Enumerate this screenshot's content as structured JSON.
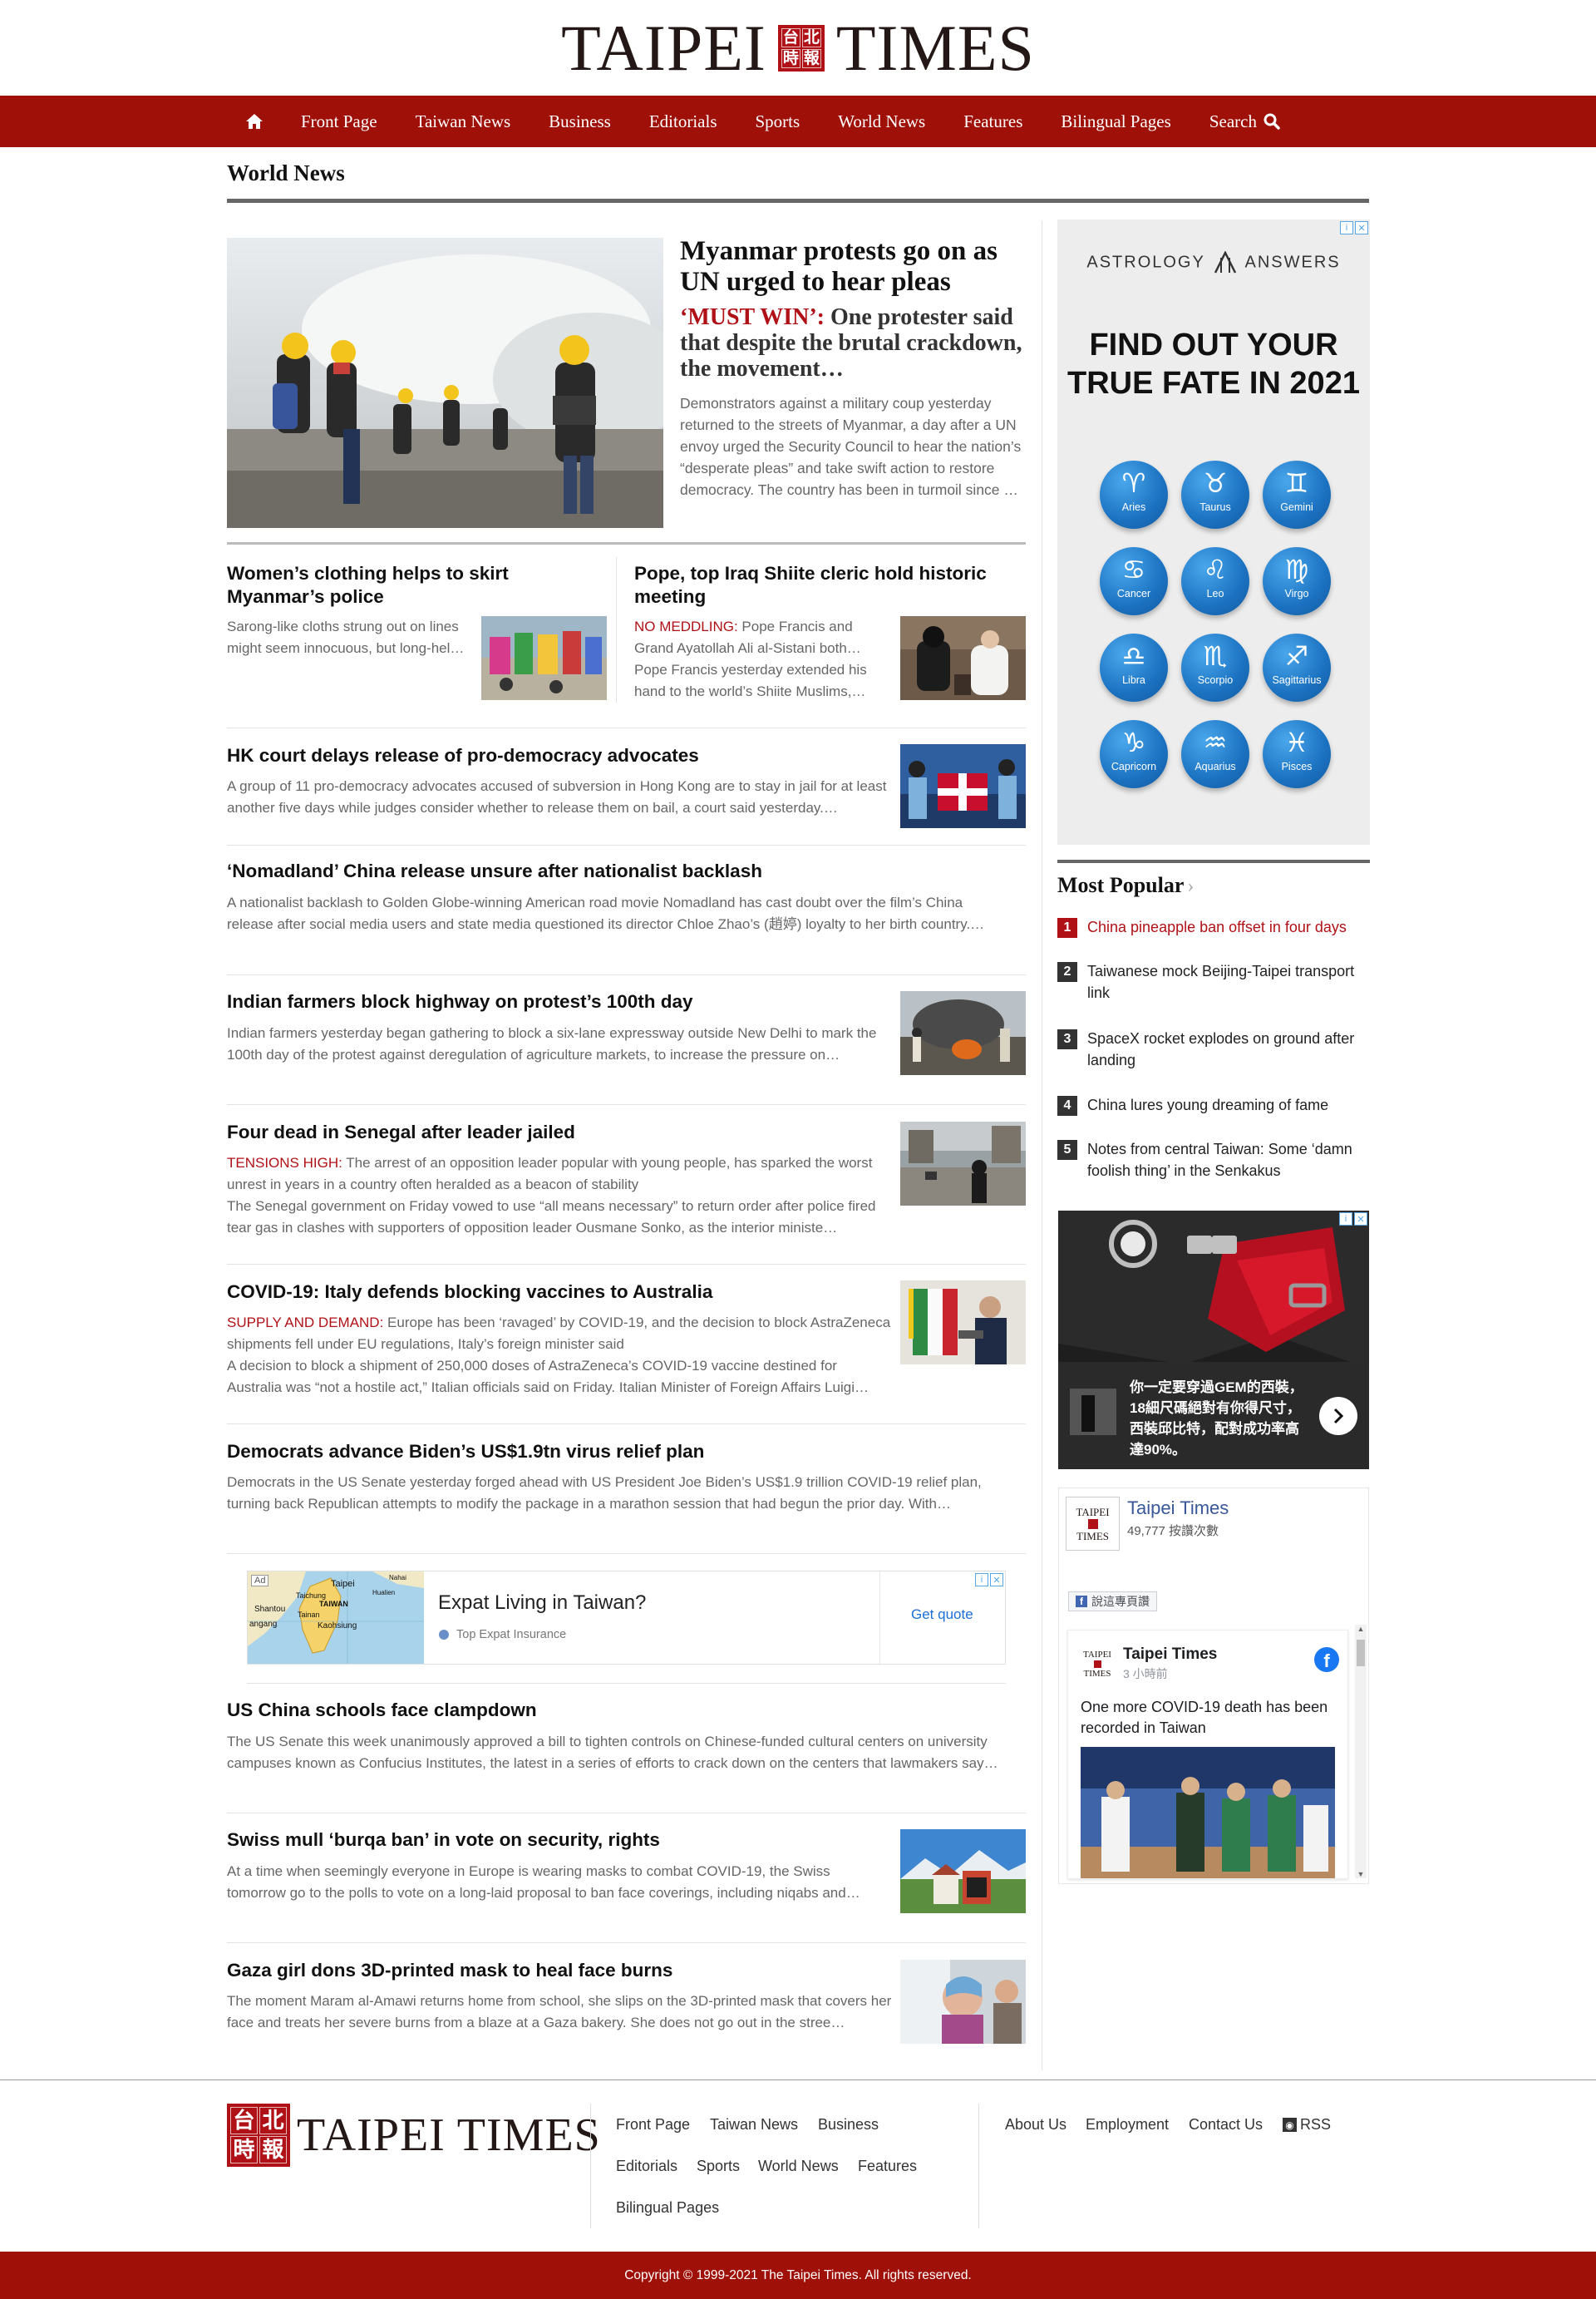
{
  "header": {
    "logo_left": "TAIPEI",
    "logo_right": "TIMES",
    "seal_chars": [
      "台",
      "北",
      "時",
      "報"
    ]
  },
  "nav": {
    "items": [
      "Front Page",
      "Taiwan News",
      "Business",
      "Editorials",
      "Sports",
      "World News",
      "Features",
      "Bilingual Pages"
    ],
    "search_label": "Search",
    "home_icon": "home-icon",
    "search_icon": "search-icon"
  },
  "section": {
    "title": "World News"
  },
  "lead": {
    "title": "Myanmar protests go on as UN urged to hear pleas",
    "kicker": "‘MUST WIN’:",
    "subtitle": " One protester said that despite the brutal crackdown, the movement…",
    "body": "Demonstrators against a military coup yesterday returned to the streets of Myanmar, a day after a UN envoy urged the Security Council to hear the nation’s “desperate pleas” and take swift action to restore democracy. The country has been in turmoil since …"
  },
  "pair": [
    {
      "title": "Women’s clothing helps to skirt Myanmar’s police",
      "body": "Sarong-like cloths strung out on lines might seem innocuous, but long-hel…"
    },
    {
      "title": "Pope, top Iraq Shiite cleric hold historic meeting",
      "kicker": "NO MEDDLING:",
      "body1": " Pope Francis and Grand Ayatollah Ali al-Sistani both…",
      "body2": "Pope Francis yesterday extended his hand to the world’s Shiite Muslims,…"
    }
  ],
  "stories": [
    {
      "title": "HK court delays release of pro-democracy advocates",
      "body": "A group of 11 pro-democracy advocates accused of subversion in Hong Kong are to stay in jail for at least another five days while judges consider whether to release them on bail, a court said yesterday.…"
    },
    {
      "title": "‘Nomadland’ China release unsure after nationalist backlash",
      "body": "A nationalist backlash to Golden Globe-winning American road movie Nomadland has cast doubt over the film’s China release after social media users and state media questioned its director Chloe Zhao’s (趙婷) loyalty to her birth country.…"
    },
    {
      "title": "Indian farmers block highway on protest’s 100th day",
      "body": "Indian farmers yesterday began gathering to block a six-lane expressway outside New Delhi to mark the 100th day of the protest against deregulation of agriculture markets, to increase the pressure on…"
    },
    {
      "title": "Four dead in Senegal after leader jailed",
      "kicker": "TENSIONS HIGH:",
      "body1": " The arrest of an opposition leader popular with young people, has sparked the worst unrest in years in a country often heralded as a beacon of stability",
      "body2": "The Senegal government on Friday vowed to use “all means necessary” to return order after police fired tear gas in clashes with supporters of opposition leader Ousmane Sonko, as the interior ministe…"
    },
    {
      "title": "COVID-19: Italy defends blocking vaccines to Australia",
      "kicker": "SUPPLY AND DEMAND:",
      "body1": " Europe has been ‘ravaged’ by COVID-19, and the decision to block AstraZeneca shipments fell under EU regulations, Italy’s foreign minister said",
      "body2": "A decision to block a shipment of 250,000 doses of AstraZeneca’s COVID-19 vaccine destined for Australia was “not a hostile act,” Italian officials said on Friday. Italian Minister of Foreign Affairs Luigi…"
    },
    {
      "title": "Democrats advance Biden’s US$1.9tn virus relief plan",
      "body": "Democrats in the US Senate yesterday forged ahead with US President Joe Biden’s US$1.9 trillion COVID-19 relief plan, turning back Republican attempts to modify the package in a marathon session that had begun the prior day. With…"
    },
    {
      "title": "US China schools face clampdown",
      "body": "The US Senate this week unanimously approved a bill to tighten controls on Chinese-funded cultural centers on university campuses known as Confucius Institutes, the latest in a series of efforts to crack down on the centers that lawmakers say…"
    },
    {
      "title": "Swiss mull ‘burqa ban’ in vote on security, rights",
      "body": "At a time when seemingly everyone in Europe is wearing masks to combat COVID-19, the Swiss tomorrow go to the polls to vote on a long-laid proposal to ban face coverings, including niqabs and…"
    },
    {
      "title": "Gaza girl dons 3D-printed mask to heal face burns",
      "body": "The moment Maram al-Amawi returns home from school, she slips on the 3D-printed mask that covers her face and treats her severe burns from a blaze at a Gaza bakery. She does not go out in the stree…"
    }
  ],
  "inline_ad": {
    "badge": "Ad",
    "title": "Expat Living in Taiwan?",
    "sponsor": "Top Expat Insurance",
    "cta": "Get quote",
    "map_labels": [
      "Taipei",
      "TAIWAN",
      "Taichung",
      "Tainan",
      "Kaohsiung",
      "Shantou",
      "angang",
      "Nahai",
      "Hualien"
    ]
  },
  "astrology_ad": {
    "brand_left": "ASTROLOGY",
    "brand_right": "ANSWERS",
    "headline_1": "FIND OUT YOUR",
    "headline_2": "TRUE FATE IN 2021",
    "signs": [
      {
        "name": "Aries",
        "symbol": "♈"
      },
      {
        "name": "Taurus",
        "symbol": "♉"
      },
      {
        "name": "Gemini",
        "symbol": "♊"
      },
      {
        "name": "Cancer",
        "symbol": "♋"
      },
      {
        "name": "Leo",
        "symbol": "♌"
      },
      {
        "name": "Virgo",
        "symbol": "♍"
      },
      {
        "name": "Libra",
        "symbol": "♎"
      },
      {
        "name": "Scorpio",
        "symbol": "♏"
      },
      {
        "name": "Sagittarius",
        "symbol": "♐"
      },
      {
        "name": "Capricorn",
        "symbol": "♑"
      },
      {
        "name": "Aquarius",
        "symbol": "♒"
      },
      {
        "name": "Pisces",
        "symbol": "♓"
      }
    ]
  },
  "most_popular": {
    "title": "Most Popular",
    "chevron": "›",
    "items": [
      {
        "num": "1",
        "text": "China pineapple ban offset in four days"
      },
      {
        "num": "2",
        "text": "Taiwanese mock Beijing-Taipei transport link"
      },
      {
        "num": "3",
        "text": "SpaceX rocket explodes on ground after landing"
      },
      {
        "num": "4",
        "text": "China lures young dreaming of fame"
      },
      {
        "num": "5",
        "text": "Notes from central Taiwan: Some ‘damn foolish thing’ in the Senkakus"
      }
    ]
  },
  "suit_ad": {
    "caption": "你一定要穿過GEM的西裝，18細尺碼絕對有你得尺寸，西裝邱比特，配對成功率高達90%。"
  },
  "facebook": {
    "page_name": "Taipei Times",
    "likes": "49,777 按讚次數",
    "share_label": "說這專頁讚",
    "logo_top": "TAIPEI",
    "logo_bottom": "TIMES",
    "post_author": "Taipei Times",
    "post_time": "3 小時前",
    "post_text": "One more COVID-19 death has been recorded in Taiwan"
  },
  "footer": {
    "logo_text": "TAIPEI TIMES",
    "links_col1": [
      "Front Page",
      "Taiwan News",
      "Business",
      "Editorials",
      "Sports",
      "World News",
      "Features",
      "Bilingual Pages"
    ],
    "links_col2": [
      "About Us",
      "Employment",
      "Contact Us"
    ],
    "rss_label": "RSS",
    "copyright": "Copyright © 1999-2021 The Taipei Times. All rights reserved."
  },
  "colors": {
    "brand_red": "#9e1008",
    "kicker_red": "#b01116",
    "zodiac_blue": "#1b72c1",
    "facebook_blue": "#1877f2"
  }
}
